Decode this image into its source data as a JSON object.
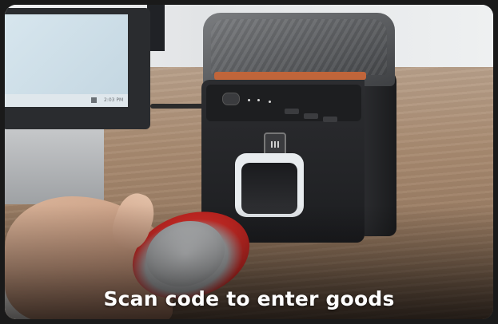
{
  "caption": "Scan code to enter goods",
  "photo": {
    "monitor_time": "2:03 PM"
  },
  "colors": {
    "caption_text": "#ffffff",
    "slot_accent": "#c0653a"
  },
  "icons": {
    "windows": "windows-logo-icon",
    "badge": "scanner-badge-icon"
  }
}
